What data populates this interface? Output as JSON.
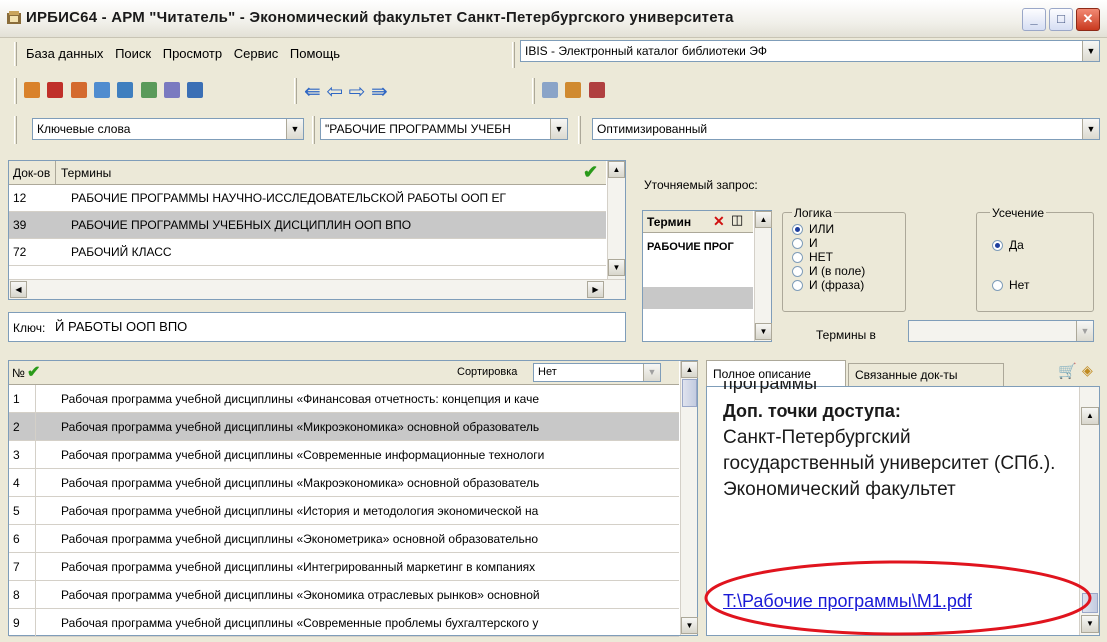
{
  "window": {
    "title": "ИРБИС64 - АРМ \"Читатель\" - Экономический факультет Санкт-Петербургского университета"
  },
  "menu": {
    "items": [
      "База данных",
      "Поиск",
      "Просмотр",
      "Сервис",
      "Помощь"
    ],
    "database": "IBIS - Электронный каталог библиотеки ЭФ"
  },
  "toolbar": {
    "icons": [
      "user-icon",
      "book-icon",
      "folder-icon",
      "search-icon",
      "view-icon",
      "tree-icon",
      "filter-icon",
      "info-icon"
    ],
    "nav": [
      "first-icon",
      "prev-icon",
      "next-icon",
      "last-icon"
    ],
    "extra": [
      "print-icon",
      "export-icon",
      "save-icon"
    ]
  },
  "search": {
    "mode": "Ключевые слова",
    "term": "\"РАБОЧИЕ ПРОГРАММЫ УЧЕБН",
    "strategy": "Оптимизированный"
  },
  "terms_table": {
    "col_count": "Док-ов",
    "col_term": "Термины",
    "rows": [
      {
        "count": "12",
        "term": "РАБОЧИЕ ПРОГРАММЫ НАУЧНО-ИССЛЕДОВАТЕЛЬСКОЙ РАБОТЫ ООП ЕГ"
      },
      {
        "count": "39",
        "term": "РАБОЧИЕ ПРОГРАММЫ УЧЕБНЫХ ДИСЦИПЛИН ООП ВПО"
      },
      {
        "count": "72",
        "term": "РАБОЧИЙ КЛАСС"
      }
    ],
    "key_label": "Ключ:",
    "key_value": "Й РАБОТЫ ООП ВПО"
  },
  "refine": {
    "label": "Уточняемый запрос:",
    "term_header": "Термин",
    "term_value": "РАБОЧИЕ ПРОГ",
    "logic_label": "Логика",
    "logic_options": [
      "ИЛИ",
      "И",
      "НЕТ",
      "И (в поле)",
      "И (фраза)"
    ],
    "truncation_label": "Усечение",
    "truncation_options": [
      "Да",
      "Нет"
    ],
    "terms_in_label": "Термины в"
  },
  "docs": {
    "col_num": "№",
    "sort_label": "Сортировка",
    "sort_value": "Нет",
    "rows": [
      {
        "n": "1",
        "text": "Рабочая программа учебной дисциплины «Финансовая отчетность: концепция и каче"
      },
      {
        "n": "2",
        "text": "Рабочая программа учебной дисциплины «Микроэкономика» основной образователь"
      },
      {
        "n": "3",
        "text": "Рабочая программа учебной дисциплины «Современные информационные технологи"
      },
      {
        "n": "4",
        "text": "Рабочая программа учебной дисциплины «Макроэкономика» основной образователь"
      },
      {
        "n": "5",
        "text": "Рабочая программа учебной дисциплины «История и методология экономической на"
      },
      {
        "n": "6",
        "text": "Рабочая программа учебной дисциплины «Эконометрика» основной образовательно"
      },
      {
        "n": "7",
        "text": "Рабочая программа учебной дисциплины «Интегрированный маркетинг в компаниях"
      },
      {
        "n": "8",
        "text": "Рабочая программа учебной дисциплины «Экономика отраслевых рынков» основной"
      },
      {
        "n": "9",
        "text": "Рабочая программа учебной дисциплины «Современные проблемы бухгалтерского у"
      }
    ]
  },
  "description": {
    "tab_full": "Полное описание",
    "tab_linked": "Связанные док-ты",
    "cut_line": "программы",
    "heading": "Доп. точки доступа:",
    "body": "Санкт-Петербургский государственный университет (СПб.). Экономический факультет",
    "link": "T:\\Рабочие программы\\М1.pdf"
  },
  "colors": {
    "highlight_ellipse": "#e0141e",
    "selected_row": "#c8c8c8",
    "link": "#1a1ad6"
  }
}
